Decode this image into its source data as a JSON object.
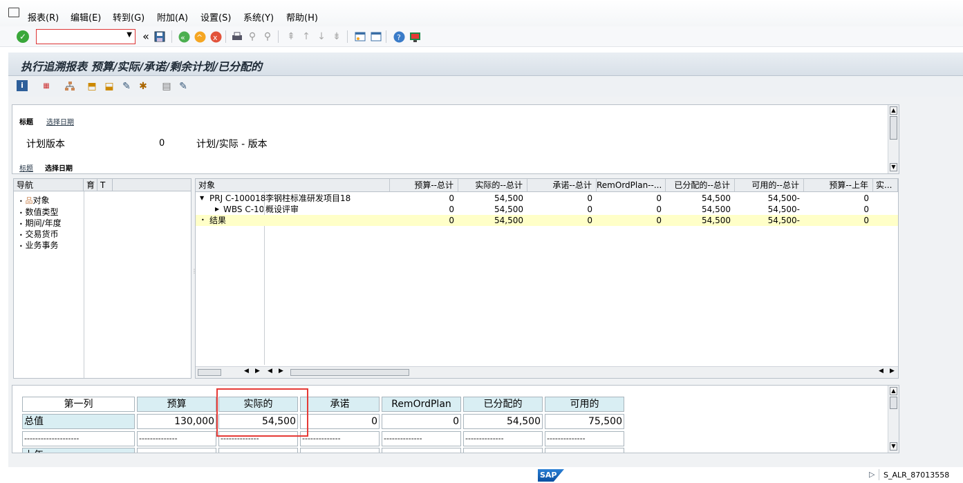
{
  "menu": {
    "items": [
      "报表(R)",
      "编辑(E)",
      "转到(G)",
      "附加(A)",
      "设置(S)",
      "系统(Y)",
      "帮助(H)"
    ]
  },
  "toolbar": {
    "command_field_value": ""
  },
  "title": "执行追溯报表 预算/实际/承诺/剩余计划/已分配的",
  "header": {
    "tab_title": "标题",
    "tab_selection_date": "选择日期",
    "plan_version_label": "计划版本",
    "plan_version_value": "0",
    "plan_version_desc": "计划/实际 - 版本",
    "bottom_tab_title": "标题",
    "bottom_tab_selection_date": "选择日期"
  },
  "navigation": {
    "headers": [
      "导航",
      "育",
      "T"
    ],
    "items": [
      "对象",
      "数值类型",
      "期间/年度",
      "交易货币",
      "业务事务"
    ]
  },
  "grid": {
    "columns": [
      "对象",
      "预算--总计",
      "实际的--总计",
      "承诺--总计",
      "RemOrdPlan--...",
      "已分配的--总计",
      "可用的--总计",
      "预算--上年",
      "实..."
    ],
    "rows": [
      {
        "object": "PRJ C-100018",
        "desc": "李钢柱标准研发项目18",
        "values": [
          "0",
          "54,500",
          "0",
          "0",
          "54,500",
          "54,500-",
          "0"
        ]
      },
      {
        "object": "WBS C-100",
        "desc": "概设评审",
        "values": [
          "0",
          "54,500",
          "0",
          "0",
          "54,500",
          "54,500-",
          "0"
        ]
      },
      {
        "object": "结果",
        "desc": "",
        "values": [
          "0",
          "54,500",
          "0",
          "0",
          "54,500",
          "54,500-",
          "0"
        ]
      }
    ]
  },
  "bottom_table": {
    "headers": [
      "第一列",
      "预算",
      "实际的",
      "承诺",
      "RemOrdPlan",
      "已分配的",
      "可用的"
    ],
    "total_label": "总值",
    "total_values": [
      "130,000",
      "54,500",
      "0",
      "0",
      "54,500",
      "75,500"
    ],
    "dash_row": [
      "--------------------",
      "--------------",
      "--------------",
      "--------------",
      "--------------",
      "--------------",
      "--------------"
    ],
    "next_label": "上年"
  },
  "status": {
    "transaction": "S_ALR_87013558",
    "logo_text": "SAP"
  },
  "colors": {
    "highlight_row": "#ffffc8",
    "header_cell": "#d9eef3",
    "red_box": "#e53935"
  }
}
